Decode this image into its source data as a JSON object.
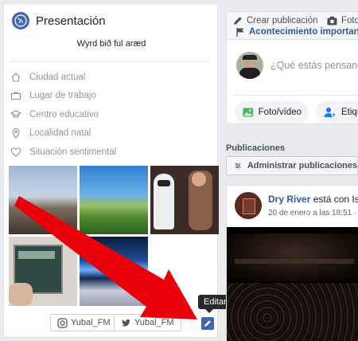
{
  "intro": {
    "title": "Presentación",
    "bio": "Wyrd bið ful aræd",
    "items": [
      {
        "label": "Ciudad actual",
        "icon": "house-icon"
      },
      {
        "label": "Lugar de trabajo",
        "icon": "briefcase-icon"
      },
      {
        "label": "Centro educativo",
        "icon": "graduation-cap-icon"
      },
      {
        "label": "Localidad natal",
        "icon": "map-pin-icon"
      },
      {
        "label": "Situación sentimental",
        "icon": "heart-icon"
      }
    ],
    "social": [
      {
        "label": "Yubal_FM",
        "icon": "instagram-icon"
      },
      {
        "label": "Yubal_FM",
        "icon": "twitter-icon"
      }
    ],
    "tooltip": "Editar"
  },
  "composer": {
    "tab_create": "Crear publicación",
    "tab_photo": "Foto",
    "tab_event": "Acontecimiento importante",
    "placeholder": "¿Qué estás pensando",
    "btn_photo_video": "Foto/vídeo",
    "btn_tag": "Etiqu"
  },
  "feed": {
    "section_title": "Publicaciones",
    "manage_button": "Administrar publicaciones"
  },
  "post": {
    "author": "Dry River",
    "action": "está con Isa",
    "date": "20 de enero a las 18:51 ·"
  },
  "colors": {
    "brand": "#4267b2",
    "link": "#365899",
    "arrow": "#e8000b"
  }
}
